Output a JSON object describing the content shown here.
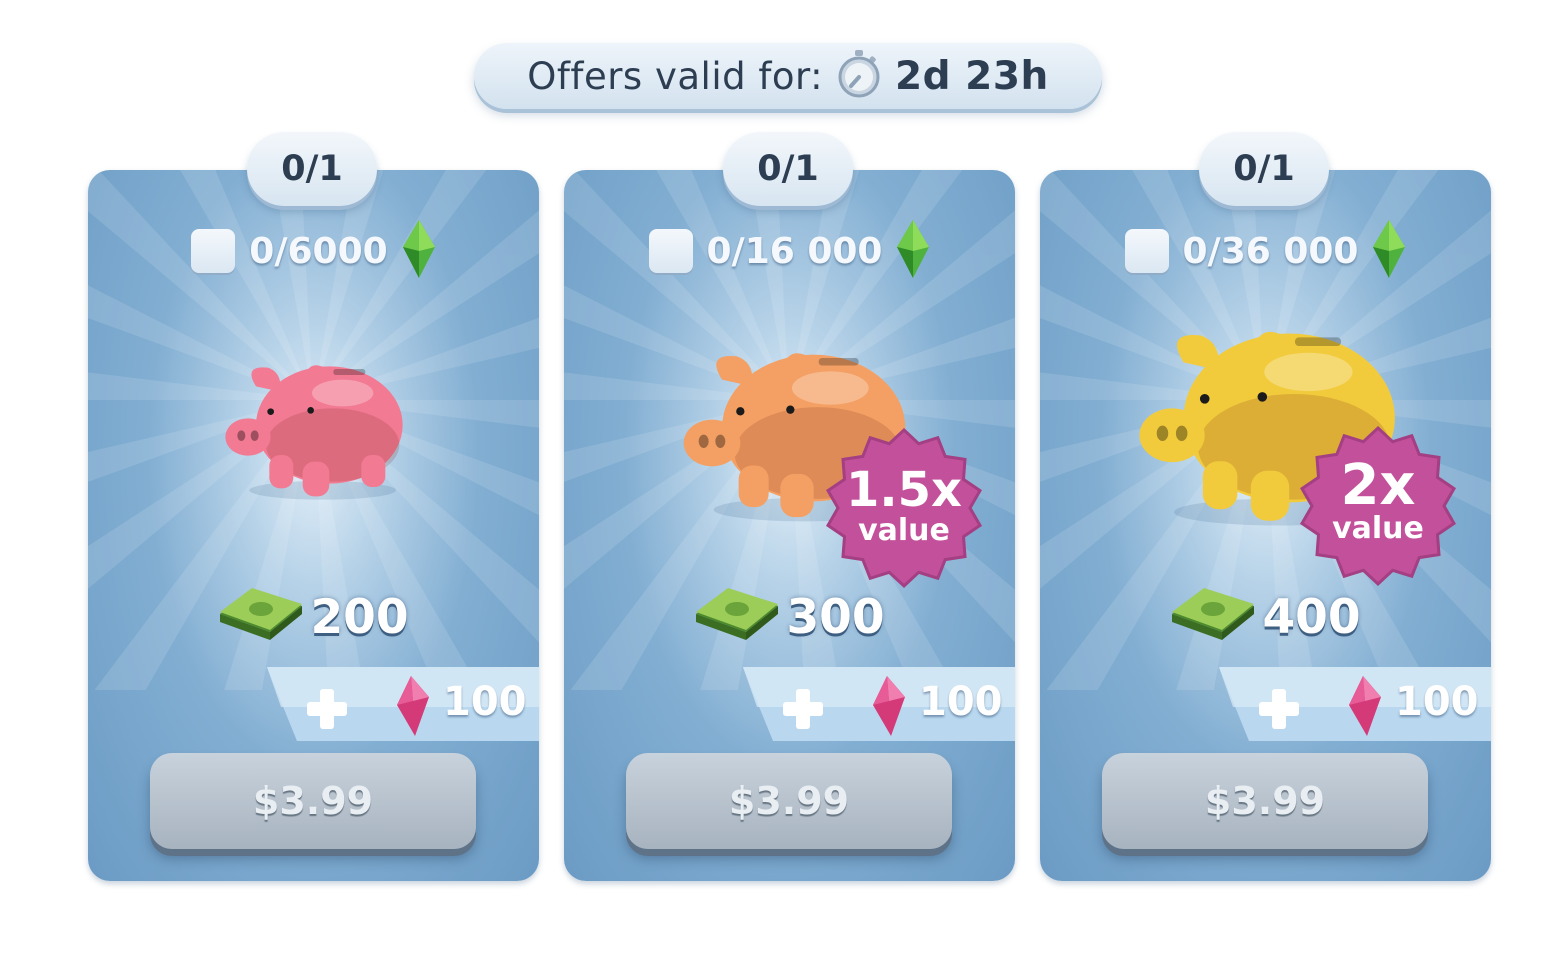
{
  "header": {
    "timer_label": "Offers valid for:",
    "timer_value": "2d 23h",
    "timer_icon": "stopwatch-icon"
  },
  "offers": [
    {
      "stock": "0/1",
      "progress": "0/6000",
      "pig_color": "#f27a93",
      "cash": "200",
      "bonus": "100",
      "price": "$3.99"
    },
    {
      "stock": "0/1",
      "progress": "0/16 000",
      "pig_color": "#f4a064",
      "cash": "300",
      "bonus": "100",
      "price": "$3.99",
      "badge": {
        "multiplier": "1.5x",
        "label": "value"
      }
    },
    {
      "stock": "0/1",
      "progress": "0/36 000",
      "pig_color": "#f2cb3c",
      "cash": "400",
      "bonus": "100",
      "price": "$3.99",
      "badge": {
        "multiplier": "2x",
        "label": "value"
      }
    }
  ],
  "icons": {
    "progress": "green-plumbob-icon",
    "cash": "cash-stack-icon",
    "bonus": "pink-gem-icon",
    "plus": "plus-icon"
  },
  "colors": {
    "card": "#7aa8cf",
    "badge": "#c2509a",
    "button": "#b7c2cd"
  }
}
